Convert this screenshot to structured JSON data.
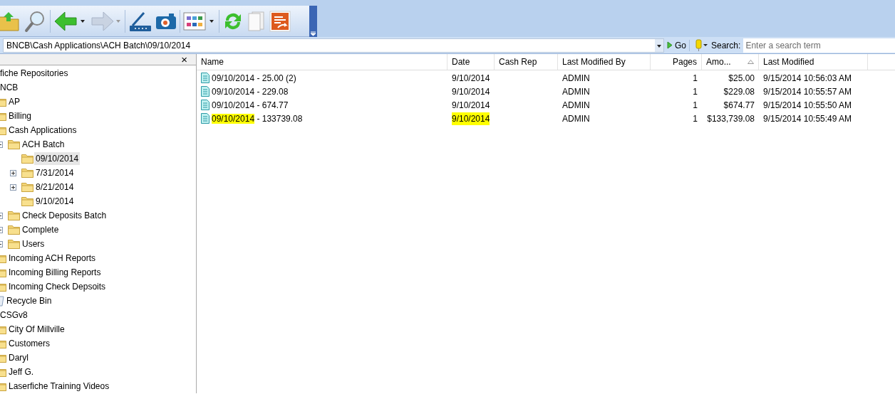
{
  "address_bar": {
    "path": "BNCB\\Cash Applications\\ACH Batch\\09/10/2014",
    "go_label": "Go",
    "search_label": "Search:",
    "search": {
      "placeholder": "Enter a search term"
    }
  },
  "tree": {
    "close_label": "×",
    "items": [
      {
        "label": "fiche Repositories",
        "selected": false,
        "children": [
          {
            "label": "NCB",
            "selected": false,
            "children": [
              {
                "label": "AP",
                "kind": "folder",
                "selected": false
              },
              {
                "label": "Billing",
                "kind": "folder",
                "selected": false
              },
              {
                "label": "Cash Applications",
                "kind": "folder",
                "selected": false,
                "children": [
                  {
                    "label": "ACH Batch",
                    "kind": "folder",
                    "expandable": true,
                    "selected": false,
                    "children": [
                      {
                        "label": "09/10/2014",
                        "kind": "folder",
                        "expandable": false,
                        "selected": true
                      },
                      {
                        "label": "7/31/2014",
                        "kind": "folder",
                        "expandable": true,
                        "selected": false
                      },
                      {
                        "label": "8/21/2014",
                        "kind": "folder",
                        "expandable": true,
                        "selected": false
                      },
                      {
                        "label": "9/10/2014",
                        "kind": "folder",
                        "expandable": false,
                        "selected": false
                      }
                    ]
                  },
                  {
                    "label": "Check Deposits Batch",
                    "kind": "folder",
                    "expandable": true,
                    "selected": false
                  },
                  {
                    "label": "Complete",
                    "kind": "folder",
                    "expandable": true,
                    "selected": false
                  },
                  {
                    "label": "Users",
                    "kind": "folder",
                    "expandable": true,
                    "selected": false
                  }
                ]
              },
              {
                "label": "Incoming ACH Reports",
                "kind": "folder",
                "selected": false
              },
              {
                "label": "Incoming Billing Reports",
                "kind": "folder",
                "selected": false
              },
              {
                "label": "Incoming Check Depsoits",
                "kind": "folder",
                "selected": false
              },
              {
                "label": "Recycle Bin",
                "kind": "recycle-bin",
                "selected": false
              }
            ]
          },
          {
            "label": "CSGv8",
            "selected": false,
            "children": [
              {
                "label": "City Of Millville",
                "kind": "folder",
                "selected": false
              },
              {
                "label": "Customers",
                "kind": "folder",
                "selected": false
              },
              {
                "label": "Daryl",
                "kind": "folder",
                "selected": false
              },
              {
                "label": "Jeff G.",
                "kind": "folder",
                "selected": false
              },
              {
                "label": "Laserfiche Training Videos",
                "kind": "folder",
                "selected": false
              }
            ]
          }
        ]
      }
    ]
  },
  "table": {
    "columns": [
      {
        "label": "Name",
        "sorted": false
      },
      {
        "label": "Date",
        "sorted": false
      },
      {
        "label": "Cash Rep",
        "sorted": false
      },
      {
        "label": "Last Modified By",
        "sorted": false
      },
      {
        "label": "Pages",
        "sorted": false
      },
      {
        "label": "Amo...",
        "sorted": true
      },
      {
        "label": "Last Modified",
        "sorted": false
      }
    ],
    "rows": [
      {
        "name": [
          {
            "text": "09/10/2014",
            "highlighted": false
          },
          {
            "text": " - 25.00 (2)",
            "highlighted": false
          }
        ],
        "date": {
          "text": "9/10/2014",
          "highlighted": false
        },
        "last_modified_by": "ADMIN",
        "pages": "1",
        "amount": "$25.00",
        "last_modified": "9/15/2014 10:56:03 AM"
      },
      {
        "name": [
          {
            "text": "09/10/2014",
            "highlighted": false
          },
          {
            "text": " - 229.08",
            "highlighted": false
          }
        ],
        "date": {
          "text": "9/10/2014",
          "highlighted": false
        },
        "last_modified_by": "ADMIN",
        "pages": "1",
        "amount": "$229.08",
        "last_modified": "9/15/2014 10:55:57 AM"
      },
      {
        "name": [
          {
            "text": "09/10/2014",
            "highlighted": false
          },
          {
            "text": " - 674.77",
            "highlighted": false
          }
        ],
        "date": {
          "text": "9/10/2014",
          "highlighted": false
        },
        "last_modified_by": "ADMIN",
        "pages": "1",
        "amount": "$674.77",
        "last_modified": "9/15/2014 10:55:50 AM"
      },
      {
        "name": [
          {
            "text": "09/10/2014",
            "highlighted": true
          },
          {
            "text": " - 133739.08",
            "highlighted": false
          }
        ],
        "date": {
          "text": "9/10/2014",
          "highlighted": true
        },
        "last_modified_by": "ADMIN",
        "pages": "1",
        "amount": "$133,739.08",
        "last_modified": "9/15/2014 10:55:49 AM"
      }
    ]
  }
}
